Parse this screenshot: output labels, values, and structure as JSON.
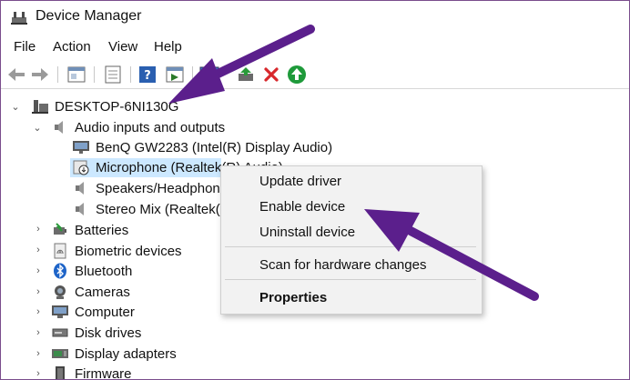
{
  "window": {
    "title": "Device Manager"
  },
  "menu": [
    "File",
    "Action",
    "View",
    "Help"
  ],
  "toolbar": {
    "buttons": [
      "back-icon",
      "forward-icon",
      "properties-icon",
      "list-icon",
      "help-icon",
      "view-icon",
      "monitor-icon",
      "update-driver-icon",
      "uninstall-icon",
      "enable-icon"
    ]
  },
  "tree": {
    "root": "DESKTOP-6NI130G",
    "category_audio": "Audio inputs and outputs",
    "audio_children": [
      "BenQ GW2283 (Intel(R) Display Audio)",
      "Microphone (Realtek(R) Audio)",
      "Speakers/Headphones (Realtek(R) Audio)",
      "Stereo Mix (Realtek(R) Audio)"
    ],
    "categories": [
      "Batteries",
      "Biometric devices",
      "Bluetooth",
      "Cameras",
      "Computer",
      "Disk drives",
      "Display adapters",
      "Firmware"
    ]
  },
  "context_menu": {
    "items": [
      "Update driver",
      "Enable device",
      "Uninstall device",
      "Scan for hardware changes",
      "Properties"
    ]
  },
  "colors": {
    "arrow": "#5b1f8c",
    "selection": "#cce8ff",
    "window_border": "#7a4d8c"
  }
}
